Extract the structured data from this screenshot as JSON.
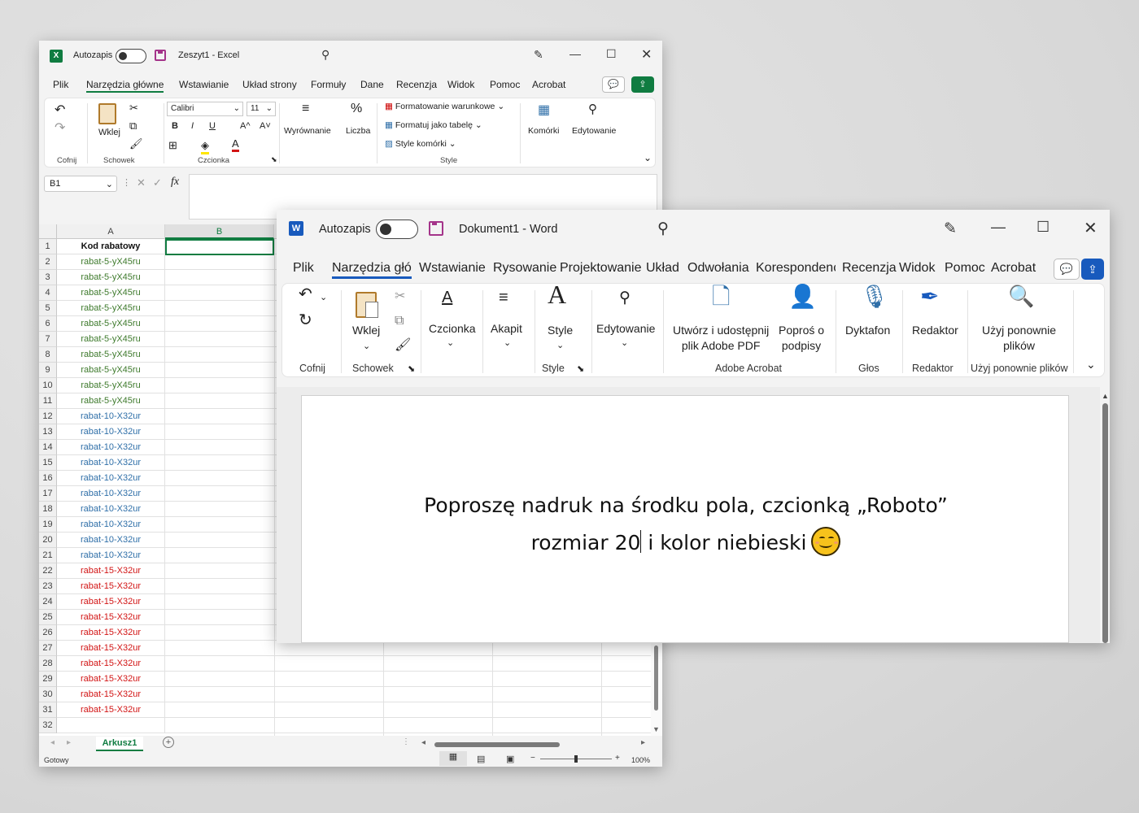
{
  "excel": {
    "title": {
      "autosave": "Autozapis",
      "doc": "Zeszyt1  -  Excel"
    },
    "tabs": [
      "Plik",
      "Narzędzia główne",
      "Wstawianie",
      "Układ strony",
      "Formuły",
      "Dane",
      "Recenzja",
      "Widok",
      "Pomoc",
      "Acrobat"
    ],
    "active_tab": "Narzędzia główne",
    "ribbon": {
      "undo_group": "Cofnij",
      "clipboard_group": "Schowek",
      "paste": "Wklej",
      "font_group": "Czcionka",
      "font_name": "Calibri",
      "font_size": "11",
      "bold": "B",
      "italic": "I",
      "underline": "U",
      "grow": "A^",
      "shrink": "A˅",
      "alignment": "Wyrównanie",
      "number": "Liczba",
      "cond_format": "Formatowanie warunkowe",
      "format_table": "Formatuj jako tabelę",
      "cell_styles": "Style komórki",
      "styles_group": "Style",
      "cells": "Komórki",
      "editing": "Edytowanie"
    },
    "name_box": "B1",
    "fx": "fx",
    "columns": [
      "A",
      "B"
    ],
    "rows": [
      {
        "n": "1",
        "a": "Kod rabatowy",
        "c": "bold"
      },
      {
        "n": "2",
        "a": "rabat-5-yX45ru",
        "c": "green"
      },
      {
        "n": "3",
        "a": "rabat-5-yX45ru",
        "c": "green"
      },
      {
        "n": "4",
        "a": "rabat-5-yX45ru",
        "c": "green"
      },
      {
        "n": "5",
        "a": "rabat-5-yX45ru",
        "c": "green"
      },
      {
        "n": "6",
        "a": "rabat-5-yX45ru",
        "c": "green"
      },
      {
        "n": "7",
        "a": "rabat-5-yX45ru",
        "c": "green"
      },
      {
        "n": "8",
        "a": "rabat-5-yX45ru",
        "c": "green"
      },
      {
        "n": "9",
        "a": "rabat-5-yX45ru",
        "c": "green"
      },
      {
        "n": "10",
        "a": "rabat-5-yX45ru",
        "c": "green"
      },
      {
        "n": "11",
        "a": "rabat-5-yX45ru",
        "c": "green"
      },
      {
        "n": "12",
        "a": "rabat-10-X32ur",
        "c": "blue"
      },
      {
        "n": "13",
        "a": "rabat-10-X32ur",
        "c": "blue"
      },
      {
        "n": "14",
        "a": "rabat-10-X32ur",
        "c": "blue"
      },
      {
        "n": "15",
        "a": "rabat-10-X32ur",
        "c": "blue"
      },
      {
        "n": "16",
        "a": "rabat-10-X32ur",
        "c": "blue"
      },
      {
        "n": "17",
        "a": "rabat-10-X32ur",
        "c": "blue"
      },
      {
        "n": "18",
        "a": "rabat-10-X32ur",
        "c": "blue"
      },
      {
        "n": "19",
        "a": "rabat-10-X32ur",
        "c": "blue"
      },
      {
        "n": "20",
        "a": "rabat-10-X32ur",
        "c": "blue"
      },
      {
        "n": "21",
        "a": "rabat-10-X32ur",
        "c": "blue"
      },
      {
        "n": "22",
        "a": "rabat-15-X32ur",
        "c": "red"
      },
      {
        "n": "23",
        "a": "rabat-15-X32ur",
        "c": "red"
      },
      {
        "n": "24",
        "a": "rabat-15-X32ur",
        "c": "red"
      },
      {
        "n": "25",
        "a": "rabat-15-X32ur",
        "c": "red"
      },
      {
        "n": "26",
        "a": "rabat-15-X32ur",
        "c": "red"
      },
      {
        "n": "27",
        "a": "rabat-15-X32ur",
        "c": "red"
      },
      {
        "n": "28",
        "a": "rabat-15-X32ur",
        "c": "red"
      },
      {
        "n": "29",
        "a": "rabat-15-X32ur",
        "c": "red"
      },
      {
        "n": "30",
        "a": "rabat-15-X32ur",
        "c": "red"
      },
      {
        "n": "31",
        "a": "rabat-15-X32ur",
        "c": "red"
      },
      {
        "n": "32",
        "a": "",
        "c": "none"
      }
    ],
    "sheet_tab": "Arkusz1",
    "status": "Gotowy",
    "zoom": "100%",
    "colors": {
      "accent": "#107c41",
      "green_text": "#3e7a2c",
      "blue_text": "#2f6fa8",
      "red_text": "#d21414"
    }
  },
  "word": {
    "title": {
      "autosave": "Autozapis",
      "doc": "Dokument1  -  Word"
    },
    "tabs": [
      "Plik",
      "Narzędzia głó",
      "Wstawianie",
      "Rysowanie",
      "Projektowanie",
      "Układ",
      "Odwołania",
      "Korespondenc",
      "Recenzja",
      "Widok",
      "Pomoc",
      "Acrobat"
    ],
    "active_tab": "Narzędzia głó",
    "ribbon": {
      "undo_group": "Cofnij",
      "paste": "Wklej",
      "clipboard_group": "Schowek",
      "font": "Czcionka",
      "paragraph": "Akapit",
      "style": "Style",
      "styles_group": "Style",
      "editing": "Edytowanie",
      "create_pdf_line1": "Utwórz i udostępnij",
      "create_pdf_line2": "plik Adobe PDF",
      "sign_line1": "Poproś o",
      "sign_line2": "podpisy",
      "acrobat_group": "Adobe Acrobat",
      "dictate": "Dyktafon",
      "voice_group": "Głos",
      "editor": "Redaktor",
      "editor_group": "Redaktor",
      "reuse_line1": "Użyj ponownie",
      "reuse_line2": "plików",
      "reuse_group": "Użyj ponownie plików"
    },
    "body": {
      "line1": "Poproszę nadruk na środku pola, czcionką „Roboto”",
      "line2_a": "rozmiar 20",
      "line2_b": "i kolor niebieski"
    },
    "colors": {
      "accent": "#185abd"
    }
  }
}
